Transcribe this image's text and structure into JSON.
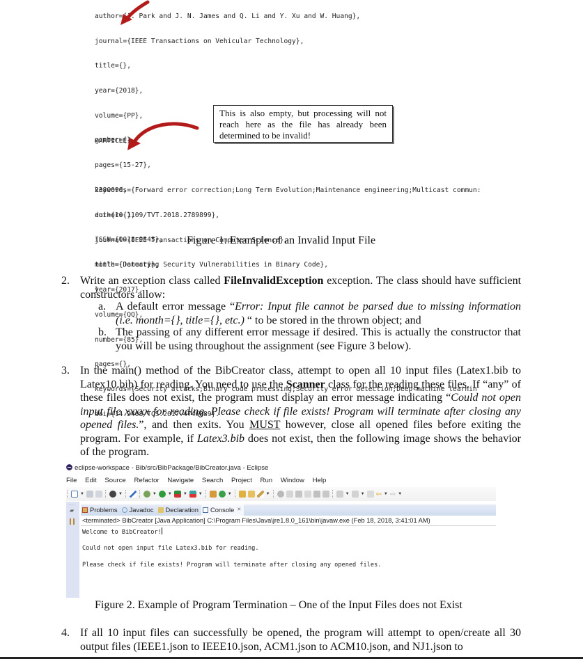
{
  "figure1": {
    "code_block_1": [
      "author={J. Park and J. N. James and Q. Li and Y. Xu and W. Huang},",
      "journal={IEEE Transactions on Vehicular Technology},",
      "title={},",
      "year={2018},",
      "volume={PP},",
      "number={},",
      "pages={15-27},",
      "keywords={Forward error correction;Long Term Evolution;Maintenance engineering;Multicast commun:",
      "doi={10.1109/TVT.2018.2789899},",
      "ISSN={0018-9545},",
      "month={January},",
      "}"
    ],
    "code_block_2": [
      "@ARTICLE{",
      "",
      "2380090,",
      "author={},",
      "journal={IEEE Transactions on Computer Science},",
      "title={Detecting Security Vulnerabilities in Binary Code},",
      "year={2017},",
      "volume={QQ},",
      "number={85},",
      "pages={},",
      "keywords={Security attacks;Binary code processing;Security error detection;Deep machine learnin",
      "doi={14.2408/TCS.2017.4746889}."
    ],
    "callout": "This is also empty, but processing will not reach here as the file has already been determined to be invalid!",
    "caption": "Figure 1. Example of an Invalid Input File",
    "arrow_color": "#b31b1b"
  },
  "item2": {
    "number": "2.",
    "text_before": "Write an exception class called ",
    "bold": "FileInvalidException",
    "text_after": " exception. The class should have sufficient constructors allow:",
    "sub_a": {
      "letter": "a.",
      "text_before": "A default error message “",
      "italic": "Error: Input file cannot be parsed due to missing information (i.e. month={}, title={}, etc.)",
      "text_after": " “ to be stored in the thrown object; and"
    },
    "sub_b": {
      "letter": "b.",
      "text": "The passing of any different error message if desired. This is actually the constructor that you will be using throughout the assignment (see Figure 3 below)."
    }
  },
  "item3": {
    "number": "3.",
    "t1": "In the main() method of the BibCreator class, attempt to open all 10 input files (Latex1.bib to Latex10.bib) for reading. You need to use the ",
    "bold": "Scanner",
    "t2": " class for the reading these files. If “any” of these files does not exist, the program must display an error message indicating “",
    "italic": "Could not open input file xxxxx  for reading. Please check if file exists! Program will terminate after closing any opened files.",
    "t3": "”, and then exits. You ",
    "underline": "MUST",
    "t4": " however, close all opened files before exiting the program. For example, if ",
    "italic2": "Latex3.bib",
    "t5": " does not exist, then the following image shows the behavior of the program."
  },
  "eclipse": {
    "window_title": "eclipse-workspace - Bib/src/BibPackage/BibCreator.java - Eclipse",
    "menu": [
      "File",
      "Edit",
      "Source",
      "Refactor",
      "Navigate",
      "Search",
      "Project",
      "Run",
      "Window",
      "Help"
    ],
    "tabs": [
      {
        "label": "Problems",
        "icon": "problems-icon"
      },
      {
        "label": "Javadoc",
        "icon": "javadoc-icon"
      },
      {
        "label": "Declaration",
        "icon": "declaration-icon"
      },
      {
        "label": "Console",
        "icon": "console-icon",
        "close": "✕"
      }
    ],
    "console_label": "<terminated> BibCreator [Java Application] C:\\Program Files\\Java\\jre1.8.0_161\\bin\\javaw.exe (Feb 18, 2018, 3:41:01 AM)",
    "output": [
      "Welcome to BibCreator!",
      "Could not open input file Latex3.bib for reading.",
      "Please check if file exists! Program will terminate after closing any opened files."
    ]
  },
  "figure2": {
    "caption": "Figure 2. Example of Program Termination – One of the Input Files does not Exist"
  },
  "item4": {
    "number": "4.",
    "text": "If all 10 input files can successfully be opened, the program will attempt to open/create all 30 output files (IEEE1.json to IEEE10.json, ACM1.json to ACM10.json, and NJ1.json to"
  }
}
